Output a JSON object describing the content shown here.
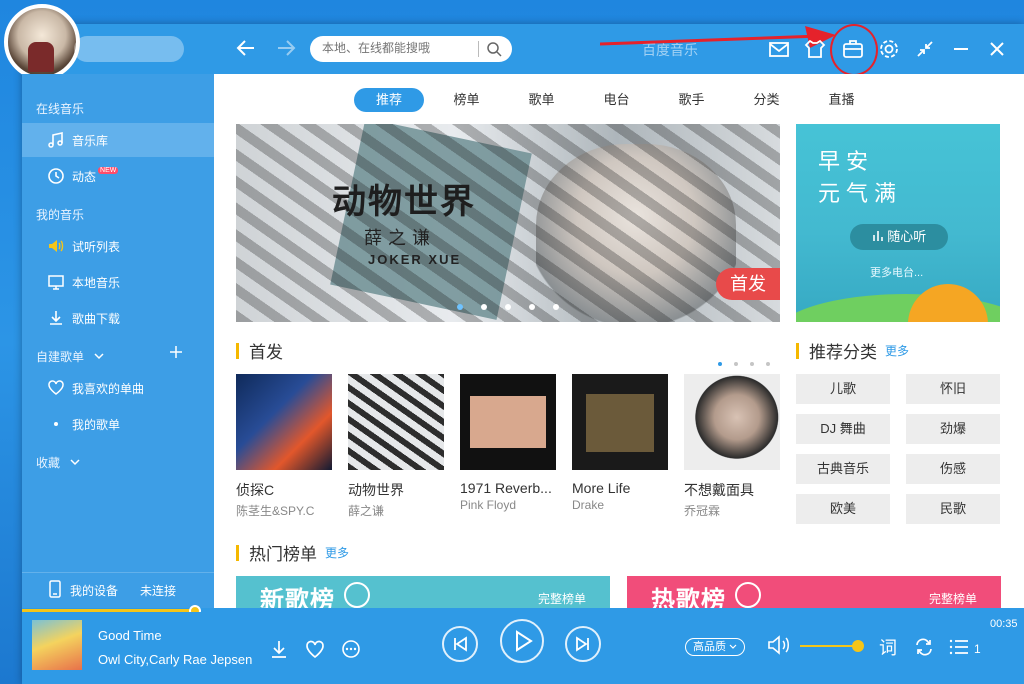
{
  "search": {
    "placeholder": "本地、在线都能搜哦"
  },
  "brand": "百度音乐",
  "sidebar": {
    "section_online": "在线音乐",
    "items_online": [
      {
        "label": "音乐库",
        "icon": "music-note-icon",
        "active": true
      },
      {
        "label": "动态",
        "icon": "dynamic-icon",
        "badge": "NEW"
      }
    ],
    "section_mine": "我的音乐",
    "items_mine": [
      {
        "label": "试听列表",
        "icon": "speaker-icon"
      },
      {
        "label": "本地音乐",
        "icon": "monitor-icon"
      },
      {
        "label": "歌曲下载",
        "icon": "download-icon"
      }
    ],
    "section_playlist": "自建歌单",
    "items_playlist": [
      {
        "label": "我喜欢的单曲",
        "icon": "heart-icon"
      },
      {
        "label": "我的歌单",
        "icon": "dot-icon"
      }
    ],
    "section_collect": "收藏",
    "device_label": "我的设备",
    "device_status": "未连接"
  },
  "tabs": [
    "推荐",
    "榜单",
    "歌单",
    "电台",
    "歌手",
    "分类",
    "直播"
  ],
  "banner": {
    "title": "动物世界",
    "artist": "薛之谦",
    "sub": "JOKER XUE",
    "tag": "首发"
  },
  "side_banner": {
    "line1": "早安",
    "line2": "元气满",
    "button": "随心听",
    "more": "更多电台..."
  },
  "section_new": "首发",
  "section_category": "推荐分类",
  "section_chart": "热门榜单",
  "more_label": "更多",
  "albums": [
    {
      "name": "侦探C",
      "artist": "陈茎生&SPY.C"
    },
    {
      "name": "动物世界",
      "artist": "薛之谦"
    },
    {
      "name": "1971 Reverb...",
      "artist": "Pink Floyd"
    },
    {
      "name": "More Life",
      "artist": "Drake"
    },
    {
      "name": "不想戴面具",
      "artist": "乔冠霖"
    }
  ],
  "categories": [
    "儿歌",
    "怀旧",
    "DJ 舞曲",
    "劲爆",
    "古典音乐",
    "伤感",
    "欧美",
    "民歌"
  ],
  "charts": [
    {
      "title": "新歌榜",
      "full": "完整榜单",
      "color": "#55c1cf"
    },
    {
      "title": "热歌榜",
      "full": "完整榜单",
      "color": "#f14d7a"
    }
  ],
  "player": {
    "title": "Good Time",
    "artist": "Owl City,Carly Rae Jepsen",
    "quality": "高品质",
    "time": "00:35",
    "lyric_label": "词",
    "queue_count": "1",
    "progress": 0.17,
    "volume": 0.9
  },
  "colors": {
    "accent": "#2f9ae6",
    "highlight": "#f5c518",
    "annotation": "#e5222b"
  }
}
